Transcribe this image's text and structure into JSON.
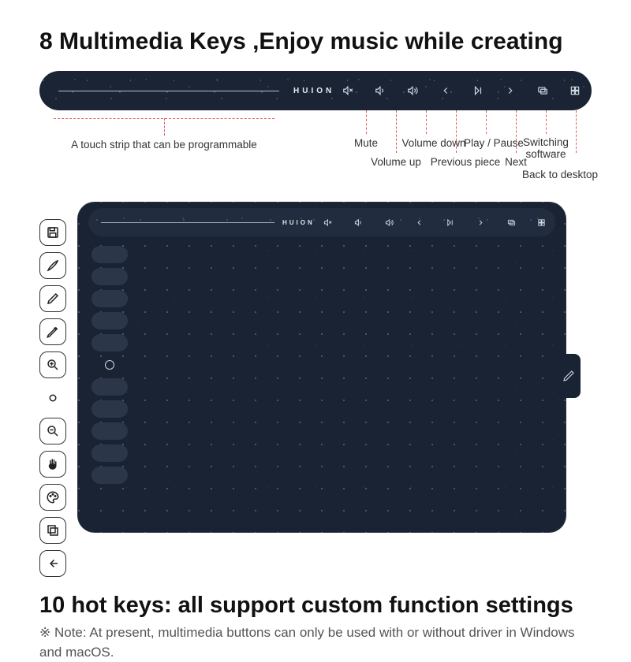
{
  "headline_top": "8 Multimedia Keys ,Enjoy music while creating",
  "brand": "HUION",
  "touch_strip_label": "A touch strip that can be programmable",
  "media_key_labels": {
    "mute": "Mute",
    "vol_up": "Volume up",
    "vol_down": "Volume down",
    "prev": "Previous piece",
    "play": "Play / Pause",
    "next": "Next",
    "switch": "Switching\nsoftware",
    "desktop": "Back to desktop"
  },
  "headline_bottom": "10 hot keys: all support custom function settings",
  "note": "※ Note: At present, multimedia buttons can only be used with or without driver in Windows and macOS.",
  "side_icons": [
    "save-icon",
    "brush-icon",
    "pen-icon",
    "stylus-icon",
    "zoom-in-icon",
    "circle-icon",
    "zoom-out-icon",
    "hand-icon",
    "palette-icon",
    "layers-icon",
    "back-icon"
  ]
}
